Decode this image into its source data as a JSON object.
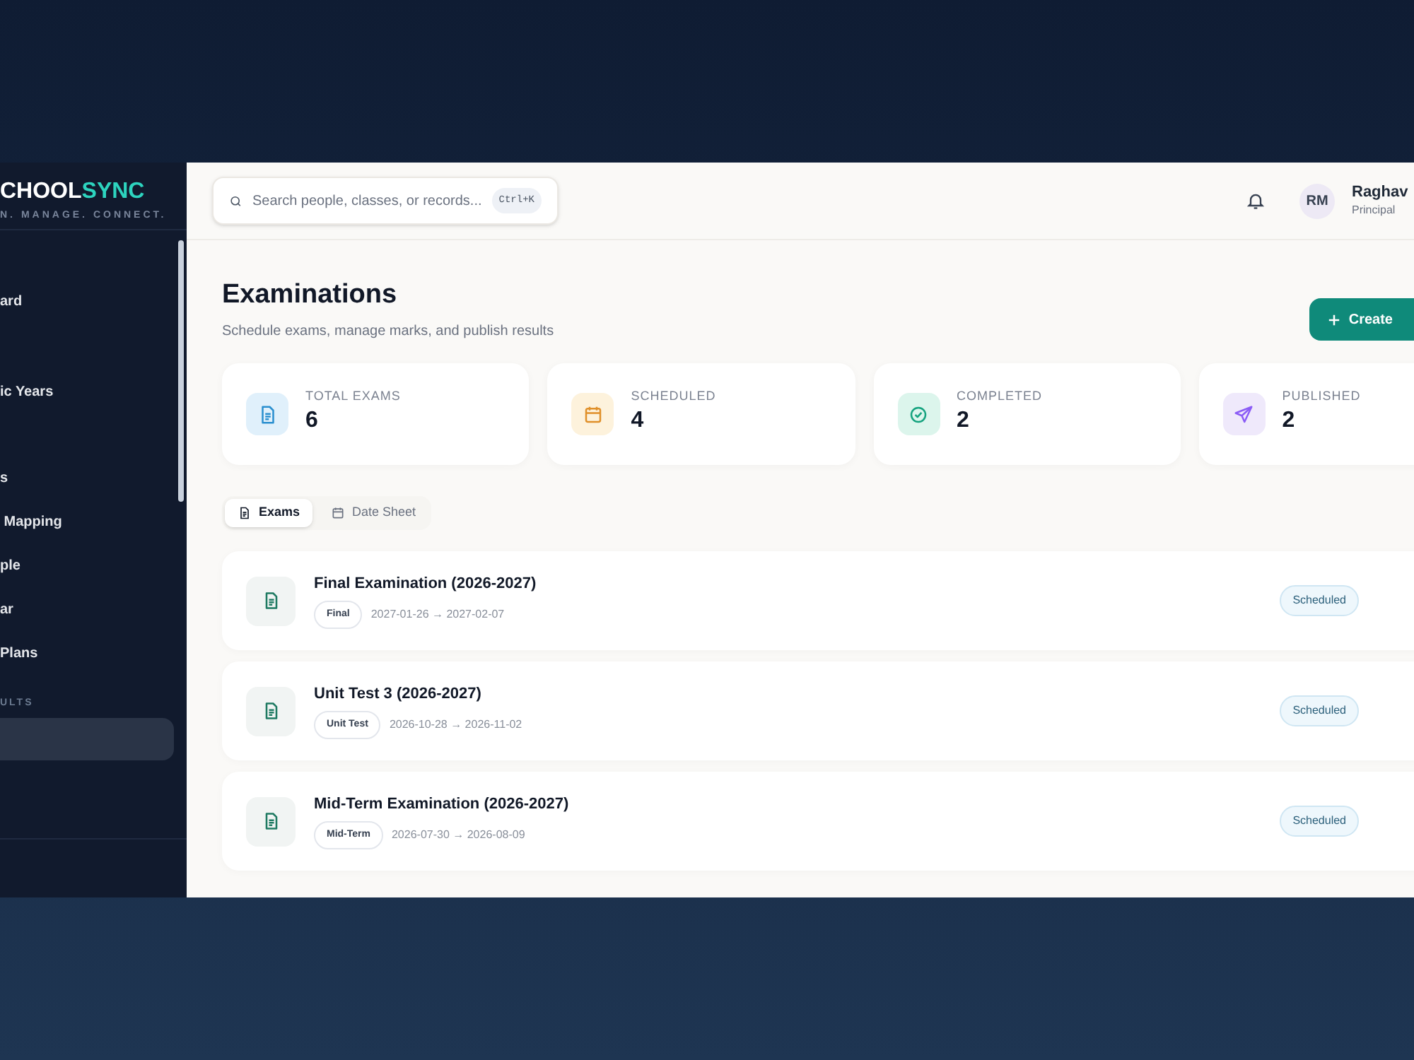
{
  "sidebar": {
    "logo": {
      "part_1": "CHOOL",
      "part_2": "SYNC"
    },
    "tagline": "N. MANAGE. CONNECT.",
    "items": [
      {
        "kind": "item",
        "label": "ard",
        "selected": false
      },
      {
        "kind": "item",
        "label": "ic Years",
        "selected": false
      },
      {
        "kind": "item",
        "label": "s",
        "selected": false
      },
      {
        "kind": "item",
        "label": " Mapping",
        "selected": false
      },
      {
        "kind": "item",
        "label": "ple",
        "selected": false
      },
      {
        "kind": "item",
        "label": "ar",
        "selected": false
      },
      {
        "kind": "item",
        "label": "Plans",
        "selected": false
      },
      {
        "kind": "section",
        "label": "ULTS"
      },
      {
        "kind": "item",
        "selected": true
      }
    ]
  },
  "header": {
    "search": {
      "placeholder": "Search people, classes, or records...",
      "shortcut": "Ctrl+K"
    },
    "user": {
      "initials": "RM",
      "name": "Raghav",
      "role": "Principal"
    }
  },
  "page": {
    "title": "Examinations",
    "subtitle": "Schedule exams, manage marks, and publish results",
    "create_button": "Create"
  },
  "stats": [
    {
      "kind": "total",
      "label": "TOTAL EXAMS",
      "value": "6"
    },
    {
      "kind": "scheduled",
      "label": "SCHEDULED",
      "value": "4"
    },
    {
      "kind": "completed",
      "label": "COMPLETED",
      "value": "2"
    },
    {
      "kind": "published",
      "label": "PUBLISHED",
      "value": "2"
    }
  ],
  "tabs": [
    {
      "kind": "exams",
      "label": "Exams",
      "selected": true
    },
    {
      "kind": "datesheet",
      "label": "Date Sheet",
      "selected": false
    }
  ],
  "exams": [
    {
      "title": "Final Examination (2026-2027)",
      "type": "Final",
      "dates": "2027-01-26 → 2027-02-07",
      "status": "Scheduled"
    },
    {
      "title": "Unit Test 3 (2026-2027)",
      "type": "Unit Test",
      "dates": "2026-10-28 → 2026-11-02",
      "status": "Scheduled"
    },
    {
      "title": "Mid-Term Examination (2026-2027)",
      "type": "Mid-Term",
      "dates": "2026-07-30 → 2026-08-09",
      "status": "Scheduled"
    }
  ]
}
